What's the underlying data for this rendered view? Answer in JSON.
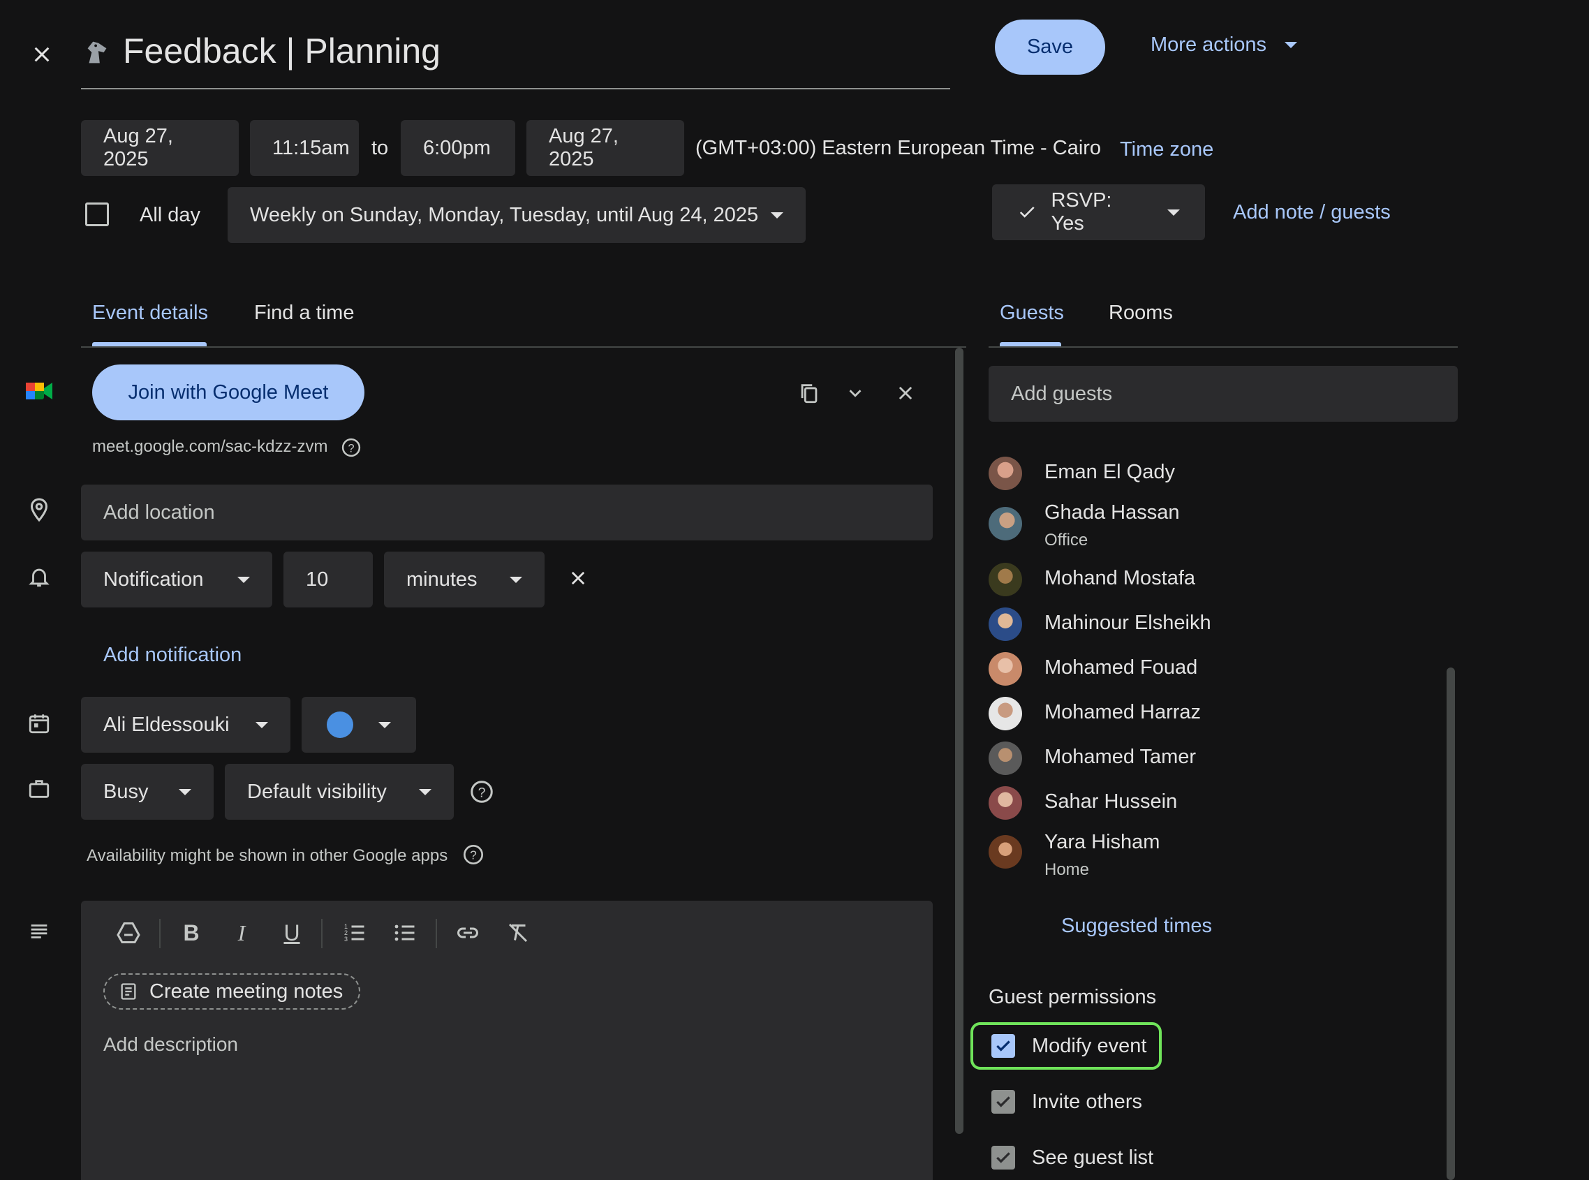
{
  "header": {
    "title": "Feedback | Planning",
    "save_label": "Save",
    "more_actions_label": "More actions"
  },
  "datetime": {
    "start_date": "Aug 27, 2025",
    "start_time": "11:15am",
    "to_label": "to",
    "end_time": "6:00pm",
    "end_date": "Aug 27, 2025",
    "timezone_text": "(GMT+03:00) Eastern European Time - Cairo",
    "timezone_link": "Time zone",
    "all_day_label": "All day",
    "recurrence": "Weekly on Sunday, Monday, Tuesday, until Aug 24, 2025"
  },
  "rsvp": {
    "label": "RSVP: Yes",
    "add_note_label": "Add note / guests"
  },
  "tabs": {
    "left": [
      {
        "label": "Event details"
      },
      {
        "label": "Find a time"
      }
    ],
    "right": [
      {
        "label": "Guests"
      },
      {
        "label": "Rooms"
      }
    ]
  },
  "meet": {
    "join_label": "Join with Google Meet",
    "link": "meet.google.com/sac-kdzz-zvm"
  },
  "location": {
    "placeholder": "Add location"
  },
  "notification": {
    "type": "Notification",
    "amount": "10",
    "unit": "minutes",
    "add_label": "Add notification"
  },
  "calendar": {
    "owner": "Ali Eldessouki",
    "color": "#4a90e2"
  },
  "availability": {
    "status": "Busy",
    "visibility": "Default visibility",
    "note": "Availability might be shown in other Google apps"
  },
  "description": {
    "create_notes_label": "Create meeting notes",
    "placeholder": "Add description"
  },
  "guests": {
    "add_placeholder": "Add guests",
    "list": [
      {
        "name": "Eman El Qady",
        "sub": ""
      },
      {
        "name": "Ghada Hassan",
        "sub": "Office"
      },
      {
        "name": "Mohand Mostafa",
        "sub": ""
      },
      {
        "name": "Mahinour Elsheikh",
        "sub": ""
      },
      {
        "name": "Mohamed Fouad",
        "sub": ""
      },
      {
        "name": "Mohamed Harraz",
        "sub": ""
      },
      {
        "name": "Mohamed Tamer",
        "sub": ""
      },
      {
        "name": "Sahar Hussein",
        "sub": ""
      },
      {
        "name": "Yara Hisham",
        "sub": "Home"
      }
    ],
    "suggested_times_label": "Suggested times"
  },
  "permissions": {
    "title": "Guest permissions",
    "items": [
      {
        "label": "Modify event",
        "checked": true
      },
      {
        "label": "Invite others",
        "checked": true
      },
      {
        "label": "See guest list",
        "checked": true
      }
    ]
  },
  "colors": {
    "accent": "#a8c7fa",
    "highlight": "#6fe35a",
    "background": "#131314"
  }
}
